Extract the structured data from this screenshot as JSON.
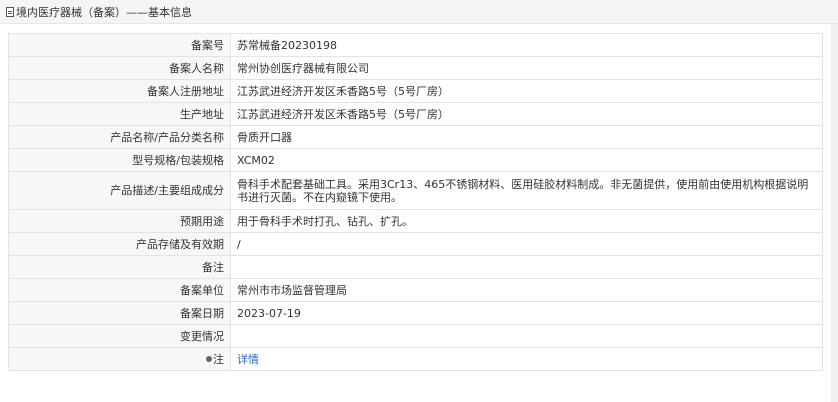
{
  "header": {
    "title": "境内医疗器械（备案）——基本信息"
  },
  "rows": [
    {
      "label": "备案号",
      "value": "苏常械备20230198"
    },
    {
      "label": "备案人名称",
      "value": "常州协创医疗器械有限公司"
    },
    {
      "label": "备案人注册地址",
      "value": "江苏武进经济开发区禾香路5号（5号厂房）"
    },
    {
      "label": "生产地址",
      "value": "江苏武进经济开发区禾香路5号（5号厂房）"
    },
    {
      "label": "产品名称/产品分类名称",
      "value": "骨质开口器"
    },
    {
      "label": "型号规格/包装规格",
      "value": "XCM02"
    },
    {
      "label": "产品描述/主要组成成分",
      "value": "骨科手术配套基础工具。采用3Cr13、465不锈钢材料、医用硅胶材料制成。非无菌提供，使用前由使用机构根据说明书进行灭菌。不在内窥镜下使用。"
    },
    {
      "label": "预期用途",
      "value": "用于骨科手术时打孔、钻孔、扩孔。"
    },
    {
      "label": "产品存储及有效期",
      "value": "/"
    },
    {
      "label": "备注",
      "value": ""
    },
    {
      "label": "备案单位",
      "value": "常州市市场监督管理局"
    },
    {
      "label": "备案日期",
      "value": "2023-07-19"
    },
    {
      "label": "变更情况",
      "value": ""
    }
  ],
  "note": {
    "label": "注",
    "link": "详情"
  },
  "icons": {
    "header": "document-icon",
    "note": "pin-icon"
  }
}
